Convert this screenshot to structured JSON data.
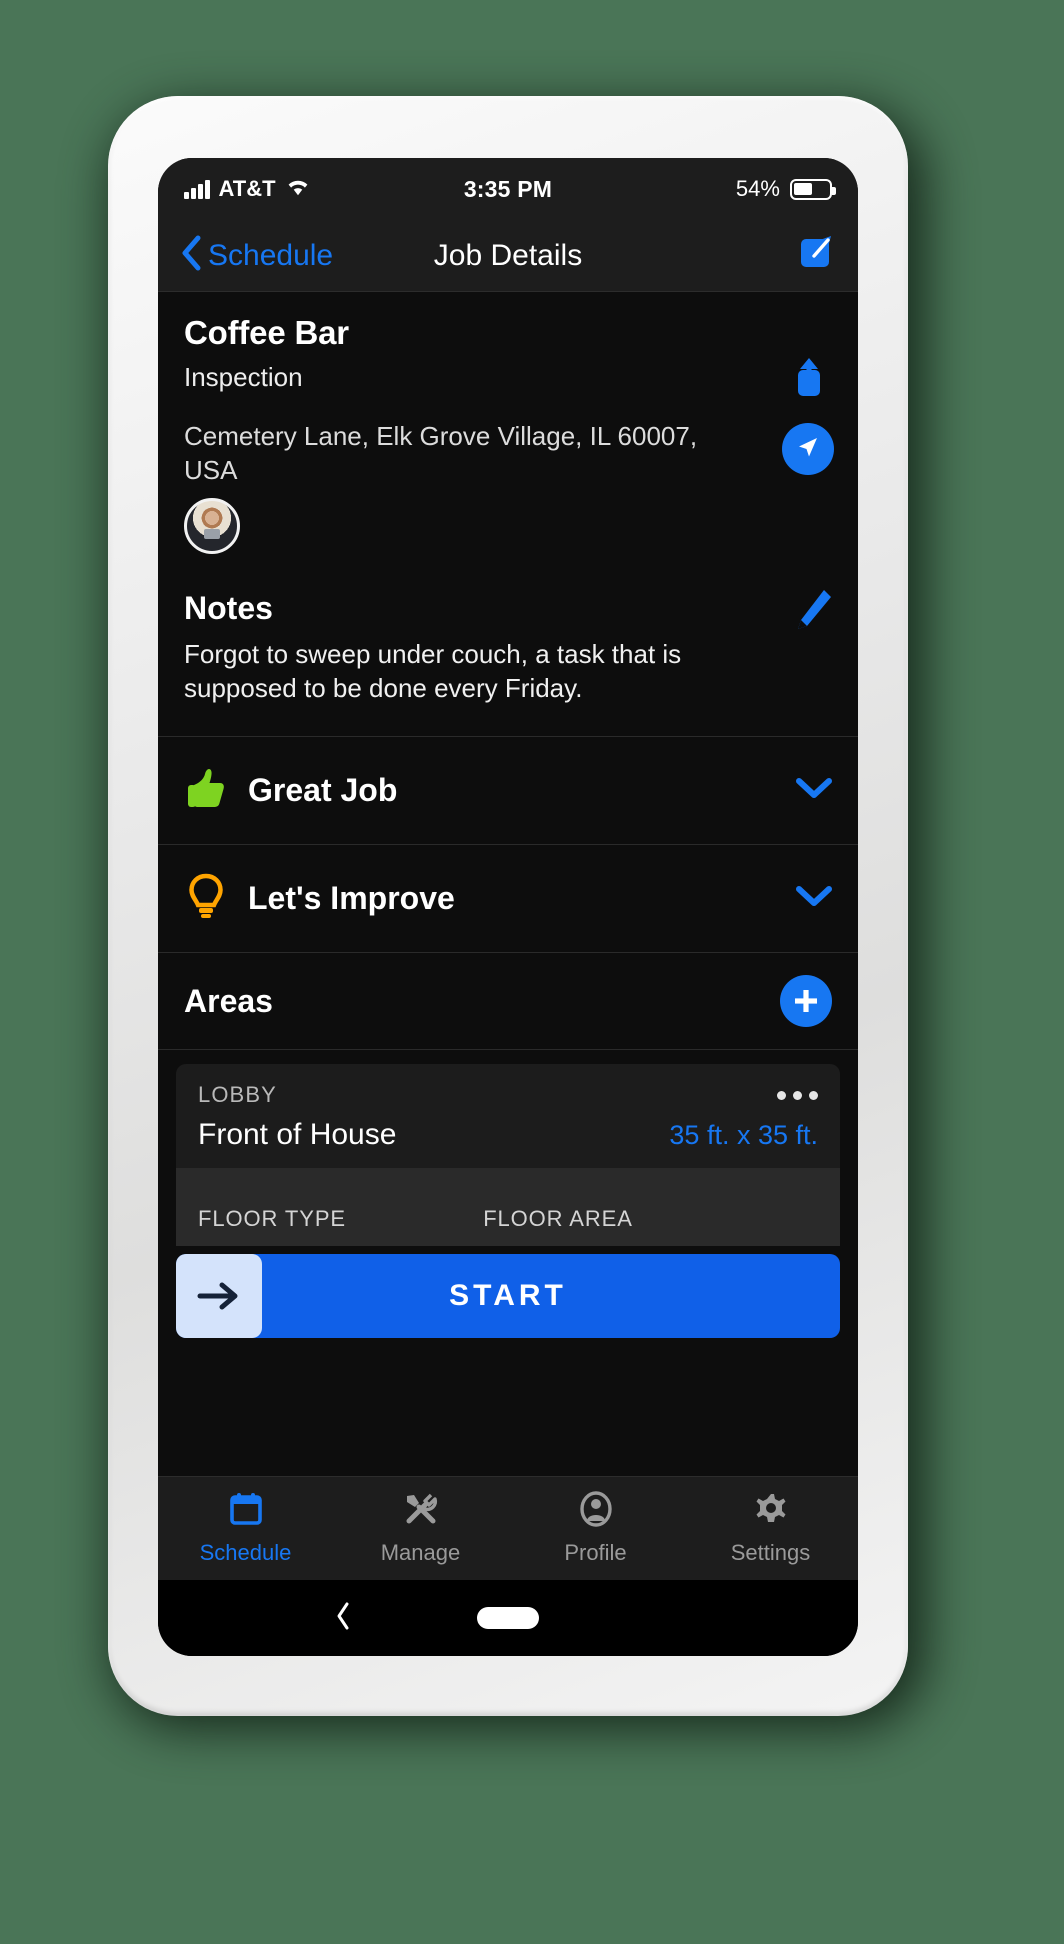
{
  "theme": {
    "page_background": "#4a7557",
    "accent_blue": "#1777f2",
    "screen_background": "#0d0d0d",
    "bar_background": "#1d1d1d",
    "card_background": "#1c1c1c",
    "green": "#7ed321",
    "orange": "#ffa400"
  },
  "status_bar": {
    "carrier": "AT&T",
    "signal_icon": "cellular-signal-icon",
    "wifi_icon": "wifi-icon",
    "time": "3:35 PM",
    "battery_percent": "54%",
    "battery_icon": "battery-icon",
    "battery_level": 54
  },
  "nav_bar": {
    "back_icon": "chevron-left-icon",
    "back_label": "Schedule",
    "title": "Job Details",
    "edit_icon": "edit-square-icon"
  },
  "job": {
    "title": "Coffee Bar",
    "type": "Inspection",
    "share_icon": "share-up-icon",
    "address": "Cemetery Lane, Elk Grove Village, IL 60007, USA",
    "navigate_icon": "navigation-arrow-icon",
    "avatar": "assignee-avatar"
  },
  "notes": {
    "title": "Notes",
    "body": "Forgot to sweep under couch, a task that is supposed to be done every Friday.",
    "edit_icon": "pencil-icon"
  },
  "sections": [
    {
      "label": "Great Job",
      "icon": "thumbs-up-icon",
      "icon_color": "#7ed321",
      "chevron": "chevron-down-icon"
    },
    {
      "label": "Let's Improve",
      "icon": "lightbulb-icon",
      "icon_color": "#ffa400",
      "chevron": "chevron-down-icon"
    }
  ],
  "areas": {
    "title": "Areas",
    "add_icon": "plus-circle-icon",
    "cards": [
      {
        "kicker": "LOBBY",
        "name": "Front of House",
        "dimensions": "35 ft. x 35 ft.",
        "menu_icon": "more-horizontal-icon",
        "columns": [
          "FLOOR TYPE",
          "FLOOR AREA"
        ]
      }
    ]
  },
  "start_button": {
    "label": "START",
    "handle_icon": "arrow-right-icon"
  },
  "tab_bar": {
    "tabs": [
      {
        "label": "Schedule",
        "icon": "calendar-icon",
        "active": true
      },
      {
        "label": "Manage",
        "icon": "tools-icon",
        "active": false
      },
      {
        "label": "Profile",
        "icon": "person-icon",
        "active": false
      },
      {
        "label": "Settings",
        "icon": "gear-icon",
        "active": false
      }
    ]
  },
  "system_bar": {
    "back_icon": "system-back-icon",
    "home_icon": "system-home-pill"
  }
}
